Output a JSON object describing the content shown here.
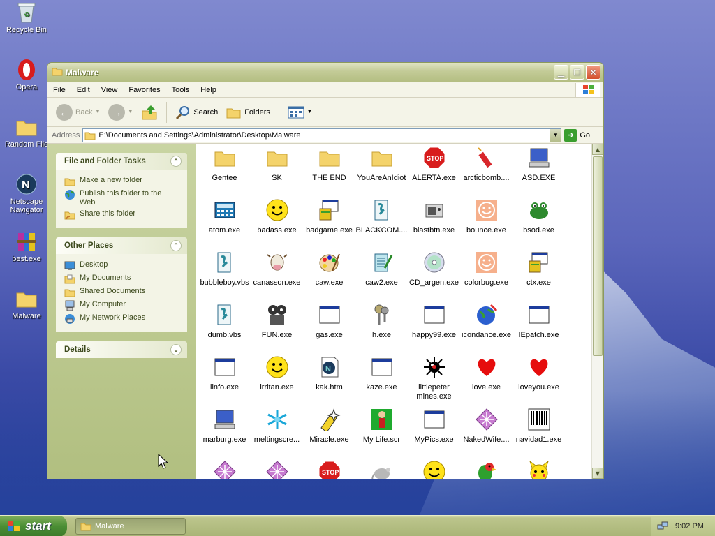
{
  "desktop": {
    "icons": [
      {
        "label": "Recycle Bin",
        "icon": "recycle-bin-icon"
      },
      {
        "label": "Opera",
        "icon": "opera-icon"
      },
      {
        "label": "Random File",
        "icon": "folder-icon"
      },
      {
        "label": "Netscape Navigator",
        "icon": "netscape-icon"
      },
      {
        "label": "best.exe",
        "icon": "winrar-icon"
      },
      {
        "label": "Malware",
        "icon": "folder-icon"
      }
    ]
  },
  "window": {
    "title": "Malware",
    "menu": [
      "File",
      "Edit",
      "View",
      "Favorites",
      "Tools",
      "Help"
    ],
    "toolbar": {
      "back": "Back",
      "search": "Search",
      "folders": "Folders"
    },
    "address": {
      "label": "Address",
      "path": "E:\\Documents and Settings\\Administrator\\Desktop\\Malware",
      "go": "Go"
    }
  },
  "tasks": {
    "file_folder": {
      "title": "File and Folder Tasks",
      "items": [
        "Make a new folder",
        "Publish this folder to the Web",
        "Share this folder"
      ]
    },
    "other_places": {
      "title": "Other Places",
      "items": [
        "Desktop",
        "My Documents",
        "Shared Documents",
        "My Computer",
        "My Network Places"
      ]
    },
    "details": {
      "title": "Details"
    }
  },
  "files": [
    {
      "name": "Gentee",
      "icon": "folder-icon"
    },
    {
      "name": "SK",
      "icon": "folder-icon"
    },
    {
      "name": "THE END",
      "icon": "folder-icon"
    },
    {
      "name": "YouAreAnIdiot",
      "icon": "folder-icon"
    },
    {
      "name": "ALERTA.exe",
      "icon": "stop-sign-icon"
    },
    {
      "name": "arcticbomb....",
      "icon": "dynamite-icon"
    },
    {
      "name": "ASD.EXE",
      "icon": "computer-icon"
    },
    {
      "name": "atom.exe",
      "icon": "calculator-icon"
    },
    {
      "name": "badass.exe",
      "icon": "smiley-icon"
    },
    {
      "name": "badgame.exe",
      "icon": "setup-icon"
    },
    {
      "name": "BLACKCOM....",
      "icon": "script-icon"
    },
    {
      "name": "blastbtn.exe",
      "icon": "speaker-icon"
    },
    {
      "name": "bounce.exe",
      "icon": "peach-smiley-icon"
    },
    {
      "name": "bsod.exe",
      "icon": "frog-icon"
    },
    {
      "name": "bubbleboy.vbs",
      "icon": "script-icon"
    },
    {
      "name": "canasson.exe",
      "icon": "cow-icon"
    },
    {
      "name": "caw.exe",
      "icon": "palette-icon"
    },
    {
      "name": "caw2.exe",
      "icon": "notepad-icon"
    },
    {
      "name": "CD_argen.exe",
      "icon": "cd-icon"
    },
    {
      "name": "colorbug.exe",
      "icon": "peach-smiley-icon"
    },
    {
      "name": "ctx.exe",
      "icon": "setup-icon"
    },
    {
      "name": "dumb.vbs",
      "icon": "script-icon"
    },
    {
      "name": "FUN.exe",
      "icon": "film-icon"
    },
    {
      "name": "gas.exe",
      "icon": "window-icon"
    },
    {
      "name": "h.exe",
      "icon": "keys-icon"
    },
    {
      "name": "happy99.exe",
      "icon": "window-icon"
    },
    {
      "name": "icondance.exe",
      "icon": "globe-icon"
    },
    {
      "name": "IEpatch.exe",
      "icon": "window-icon"
    },
    {
      "name": "iinfo.exe",
      "icon": "window-icon"
    },
    {
      "name": "irritan.exe",
      "icon": "smiley-icon"
    },
    {
      "name": "kak.htm",
      "icon": "netscape-doc-icon"
    },
    {
      "name": "kaze.exe",
      "icon": "window-icon"
    },
    {
      "name": "littlepeter mines.exe",
      "icon": "mine-icon"
    },
    {
      "name": "love.exe",
      "icon": "heart-icon"
    },
    {
      "name": "loveyou.exe",
      "icon": "heart-icon"
    },
    {
      "name": "marburg.exe",
      "icon": "computer-icon"
    },
    {
      "name": "meltingscre...",
      "icon": "snowflake-icon"
    },
    {
      "name": "Miracle.exe",
      "icon": "magic-icon"
    },
    {
      "name": "My Life.scr",
      "icon": "person-icon"
    },
    {
      "name": "MyPics.exe",
      "icon": "window-icon"
    },
    {
      "name": "NakedWife....",
      "icon": "diamond-icon"
    },
    {
      "name": "navidad1.exe",
      "icon": "barcode-icon"
    },
    {
      "name": "",
      "icon": "diamond-icon"
    },
    {
      "name": "",
      "icon": "diamond-icon"
    },
    {
      "name": "",
      "icon": "stop-sign-icon"
    },
    {
      "name": "",
      "icon": "mouse-icon"
    },
    {
      "name": "",
      "icon": "smiley-icon"
    },
    {
      "name": "",
      "icon": "parrot-icon"
    },
    {
      "name": "",
      "icon": "pikachu-icon"
    }
  ],
  "taskbar": {
    "start": "start",
    "item": "Malware",
    "clock": "9:02 PM"
  }
}
